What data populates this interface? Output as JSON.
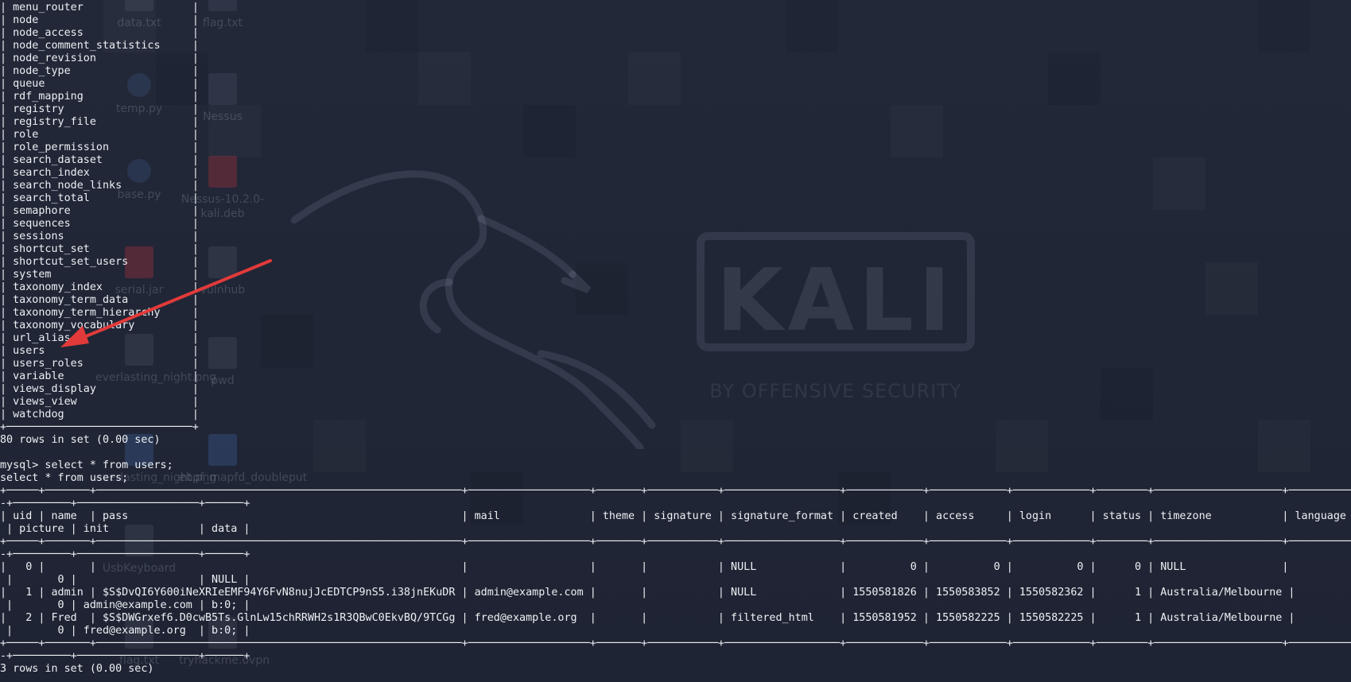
{
  "desktop": {
    "icons": [
      {
        "label": "data.txt"
      },
      {
        "label": "flag.txt"
      },
      {
        "label": "temp.py"
      },
      {
        "label": "Nessus"
      },
      {
        "label": "base.py"
      },
      {
        "label": "Nessus-10.2.0-kali.deb"
      },
      {
        "label": "serial.jar"
      },
      {
        "label": "vulnhub"
      },
      {
        "label": "everlasting_night.png"
      },
      {
        "label": "pwd"
      },
      {
        "label": "everlasting_night.png"
      },
      {
        "label": "ebpf_mapfd_doubleput"
      },
      {
        "label": "UsbKeyboard"
      },
      {
        "label": "flag.txt"
      },
      {
        "label": "tryhackme.ovpn"
      }
    ],
    "wallpaper": {
      "logo_text": "KALI",
      "tagline": "BY OFFENSIVE SECURITY",
      "colors": {
        "background": "#23283a",
        "logo": "#a0aabe"
      }
    }
  },
  "terminal": {
    "colors": {
      "text": "#eef0f4",
      "arrow": "#e23a3a"
    },
    "lines": [
      "| menu_router                 |",
      "| node                        |",
      "| node_access                 |",
      "| node_comment_statistics     |",
      "| node_revision               |",
      "| node_type                   |",
      "| queue                       |",
      "| rdf_mapping                 |",
      "| registry                    |",
      "| registry_file               |",
      "| role                        |",
      "| role_permission             |",
      "| search_dataset              |",
      "| search_index                |",
      "| search_node_links           |",
      "| search_total                |",
      "| semaphore                   |",
      "| sequences                   |",
      "| sessions                    |",
      "| shortcut_set                |",
      "| shortcut_set_users          |",
      "| system                      |",
      "| taxonomy_index              |",
      "| taxonomy_term_data          |",
      "| taxonomy_term_hierarchy     |",
      "| taxonomy_vocabulary         |",
      "| url_alias                   |",
      "| users                       |",
      "| users_roles                 |",
      "| variable                    |",
      "| views_display               |",
      "| views_view                  |",
      "| watchdog                    |",
      "+─────────────────────────────+",
      "80 rows in set (0.00 sec)",
      "",
      "mysql> select * from users;",
      "select * from users;",
      "+─────+───────+─────────────────────────────────────────────────────────+───────────────────+───────+───────────+──────────────────+────────────+────────────+────────────+────────+────────────────────+──────────",
      "-+─────────+───────────────────+──────+",
      "| uid | name  | pass                                                    | mail              | theme | signature | signature_format | created    | access     | login      | status | timezone           | language",
      " | picture | init              | data |",
      "+─────+───────+─────────────────────────────────────────────────────────+───────────────────+───────+───────────+──────────────────+────────────+────────────+────────────+────────+────────────────────+──────────",
      "-+─────────+───────────────────+──────+",
      "|   0 |       |                                                         |                   |       |           | NULL             |          0 |          0 |          0 |      0 | NULL               |",
      " |       0 |                   | NULL |",
      "|   1 | admin | $S$DvQI6Y600iNeXRIeEMF94Y6FvN8nujJcEDTCP9nS5.i38jnEKuDR | admin@example.com |       |           | NULL             | 1550581826 | 1550583852 | 1550582362 |      1 | Australia/Melbourne |",
      " |       0 | admin@example.com | b:0; |",
      "|   2 | Fred  | $S$DWGrxef6.D0cwB5Ts.GlnLw15chRRWH2s1R3QBwC0EkvBQ/9TCGg | fred@example.org  |       |           | filtered_html    | 1550581952 | 1550582225 | 1550582225 |      1 | Australia/Melbourne |",
      " |       0 | fred@example.org  | b:0; |",
      "+─────+───────+─────────────────────────────────────────────────────────+───────────────────+───────+───────────+──────────────────+────────────+────────────+────────────+────────+────────────────────+──────────",
      "-+─────────+───────────────────+──────+",
      "3 rows in set (0.00 sec)"
    ]
  }
}
